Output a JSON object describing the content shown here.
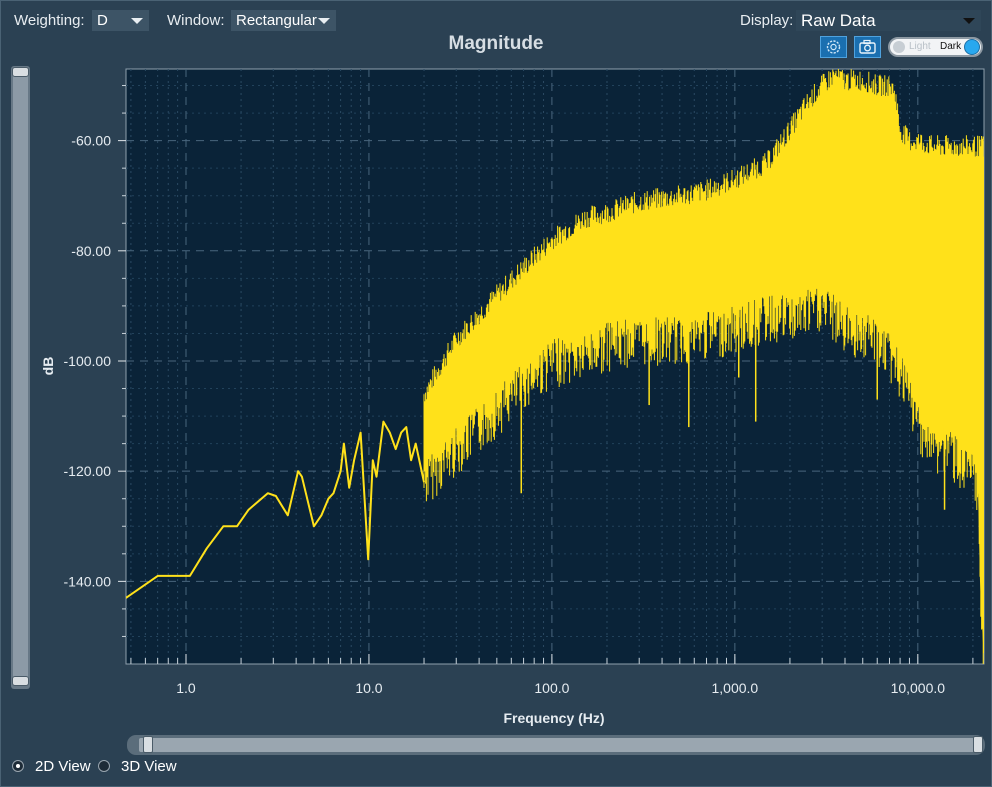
{
  "toolbar": {
    "weighting_label": "Weighting:",
    "weighting_value": "D",
    "window_label": "Window:",
    "window_value": "Rectangular",
    "display_label": "Display:",
    "display_value": "Raw Data",
    "toggle_light": "Light",
    "toggle_dark": "Dark",
    "theme": "Dark"
  },
  "view_options": {
    "option_2d": "2D View",
    "option_3d": "3D View",
    "selected": "2D View"
  },
  "colors": {
    "trace": "#ffe11a",
    "plot_bg": "#0a2338",
    "panel_bg": "#2b4153",
    "accent": "#1a6fb0"
  },
  "icons": [
    "gear-icon",
    "camera-icon"
  ],
  "chart_data": {
    "type": "line",
    "title": "Magnitude",
    "xlabel": "Frequency (Hz)",
    "ylabel": "dB",
    "x_scale": "log",
    "xlim": [
      0.47,
      23000
    ],
    "ylim": [
      -155,
      -47
    ],
    "x_ticks": [
      1,
      10,
      100,
      1000,
      10000
    ],
    "x_tick_labels": [
      "1.0",
      "10.0",
      "100.0",
      "1,000.0",
      "10,000.0"
    ],
    "y_ticks": [
      -60,
      -80,
      -100,
      -120,
      -140
    ],
    "y_tick_labels": [
      "-60.00",
      "-80.00",
      "-100.00",
      "-120.00",
      "-140.00"
    ],
    "grid": true,
    "series": [
      {
        "x": [
          0.47,
          0.7,
          1.0,
          1.05,
          1.3,
          1.6,
          1.9,
          2.2,
          2.8,
          3.1,
          3.3,
          3.6,
          4.1,
          4.3,
          4.6,
          5.0,
          5.5,
          6.0,
          6.4,
          7.0,
          7.3,
          7.8,
          8.3,
          9.0,
          9.5,
          9.9,
          10.5,
          11,
          12,
          13,
          14,
          15,
          16,
          17,
          18,
          20
        ],
        "y": [
          -143,
          -139,
          -139,
          -139,
          -134,
          -130,
          -130,
          -127,
          -124,
          -124.5,
          -126,
          -128,
          -120,
          -121,
          -125,
          -130,
          -128,
          -125,
          -124,
          -120,
          -115,
          -123,
          -118,
          -113,
          -126,
          -136,
          -118,
          -121,
          -111,
          -113,
          -116,
          -113,
          -112,
          -118,
          -115,
          -122
        ],
        "envelope": {
          "x": [
            20,
            30,
            50,
            70,
            100,
            150,
            200,
            300,
            500,
            700,
            1000,
            1500,
            2000,
            2500,
            3000,
            3500,
            4000,
            5000,
            6000,
            7000,
            7500,
            8000,
            9000,
            10000,
            12000,
            15000,
            18000,
            20000,
            21000,
            21500,
            22000,
            23000
          ],
          "upper": [
            -108,
            -98,
            -90,
            -85,
            -80,
            -76,
            -75,
            -73,
            -72,
            -71,
            -69,
            -66,
            -60,
            -55,
            -52,
            -50,
            -51,
            -51,
            -52,
            -52,
            -53,
            -60,
            -62,
            -62,
            -63,
            -63,
            -63,
            -63,
            -63,
            -63,
            -63,
            -63
          ],
          "lower": [
            -118,
            -112,
            -105,
            -100,
            -96,
            -95,
            -93,
            -92,
            -92,
            -91,
            -90,
            -88,
            -88,
            -87,
            -86,
            -88,
            -90,
            -91,
            -92,
            -95,
            -97,
            -98,
            -103,
            -107,
            -112,
            -112,
            -116,
            -117,
            -120,
            -124,
            -140,
            -153
          ]
        },
        "dips": [
          {
            "x": 68,
            "y": -124
          },
          {
            "x": 340,
            "y": -108
          },
          {
            "x": 560,
            "y": -101
          },
          {
            "x": 1050,
            "y": -103
          },
          {
            "x": 560,
            "y": -112
          },
          {
            "x": 1300,
            "y": -111
          },
          {
            "x": 14000,
            "y": -127
          },
          {
            "x": 6000,
            "y": -107
          }
        ]
      }
    ]
  }
}
